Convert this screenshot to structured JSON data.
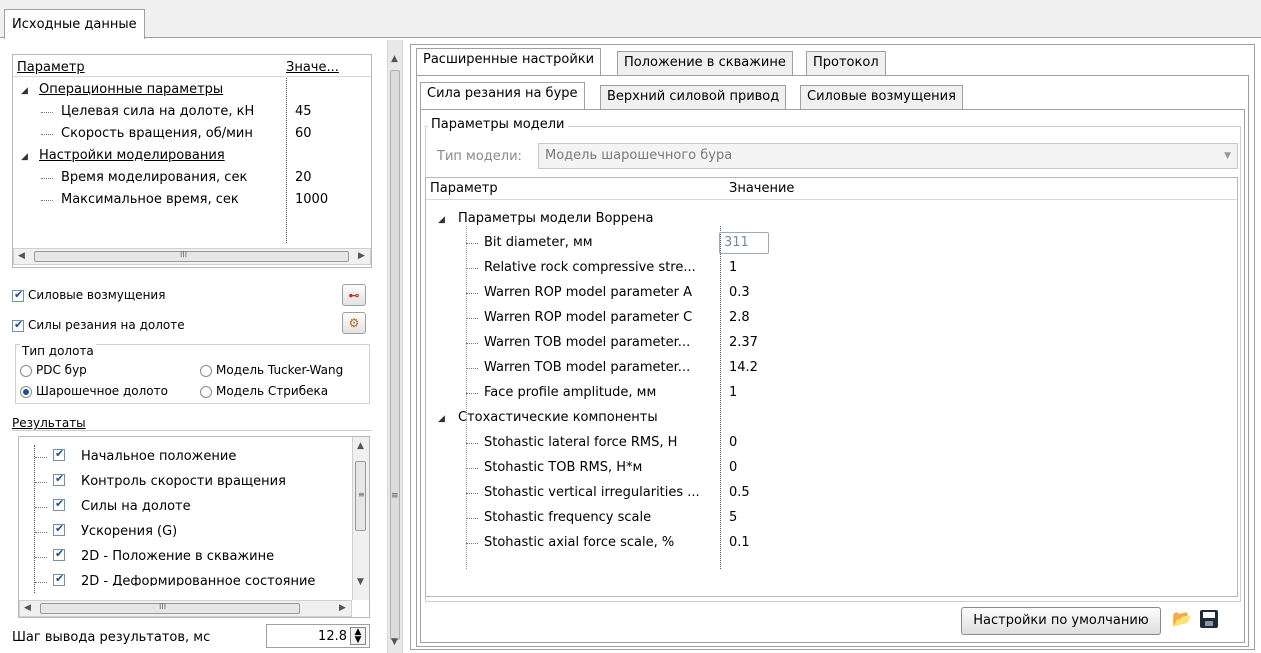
{
  "top_tab": "Исходные данные",
  "left": {
    "params_header": {
      "col1": "Параметр",
      "col2": "Значе..."
    },
    "params_rows": [
      {
        "label": "Операционные параметры",
        "category": true
      },
      {
        "label": "Целевая сила на долоте, кН",
        "value": "45"
      },
      {
        "label": "Скорость вращения, об/мин",
        "value": "60"
      },
      {
        "label": "Настройки моделирования",
        "category": true
      },
      {
        "label": "Время моделирования, сек",
        "value": "20"
      },
      {
        "label": "Максимальное время, сек",
        "value": "1000"
      }
    ],
    "scroll_glyph": "III",
    "force_disturb_label": "Силовые возмущения",
    "cutting_forces_label": "Силы резания на долоте",
    "bit_type": {
      "legend": "Тип долота",
      "options": [
        {
          "label": "PDC бур",
          "selected": false
        },
        {
          "label": "Модель Tucker-Wang",
          "selected": false
        },
        {
          "label": "Шарошечное долото",
          "selected": true
        },
        {
          "label": "Модель Стрибека",
          "selected": false
        }
      ]
    },
    "results_label": "Результаты",
    "results_items": [
      "Начальное положение",
      "Контроль скорости вращения",
      "Силы на долоте",
      "Ускорения (G)",
      "2D - Положение в скважине",
      "2D - Деформированное состояние"
    ],
    "step_label": "Шаг вывода результатов, мс",
    "step_value": "12.8"
  },
  "right": {
    "tabs": [
      "Расширенные настройки",
      "Положение в скважине",
      "Протокол"
    ],
    "subtabs": [
      "Сила резания на буре",
      "Верхний силовой привод",
      "Силовые возмущения"
    ],
    "model_params_legend": "Параметры модели",
    "model_type_label": "Тип модели:",
    "model_type_value": "Модель шарошечного бура",
    "grid_header": {
      "col1": "Параметр",
      "col2": "Значение"
    },
    "grid_rows": [
      {
        "label": "Параметры модели Воррена",
        "category": true
      },
      {
        "label": "Bit diameter, мм",
        "value": "311",
        "editing": true
      },
      {
        "label": "Relative rock compressive stre...",
        "value": "1"
      },
      {
        "label": "Warren ROP model parameter A",
        "value": "0.3"
      },
      {
        "label": "Warren ROP model parameter C",
        "value": "2.8"
      },
      {
        "label": "Warren TOB model parameter...",
        "value": "2.37"
      },
      {
        "label": "Warren TOB model parameter...",
        "value": "14.2"
      },
      {
        "label": "Face profile amplitude, мм",
        "value": "1"
      },
      {
        "label": "Стохастические компоненты",
        "category": true
      },
      {
        "label": "Stohastic lateral force RMS, Н",
        "value": "0"
      },
      {
        "label": "Stohastic TOB RMS, Н*м",
        "value": "0"
      },
      {
        "label": "Stohastic vertical irregularities ...",
        "value": "0.5"
      },
      {
        "label": "Stohastic frequency scale",
        "value": "5"
      },
      {
        "label": "Stohastic axial force scale, %",
        "value": "0.1"
      }
    ],
    "defaults_button": "Настройки по умолчанию"
  }
}
